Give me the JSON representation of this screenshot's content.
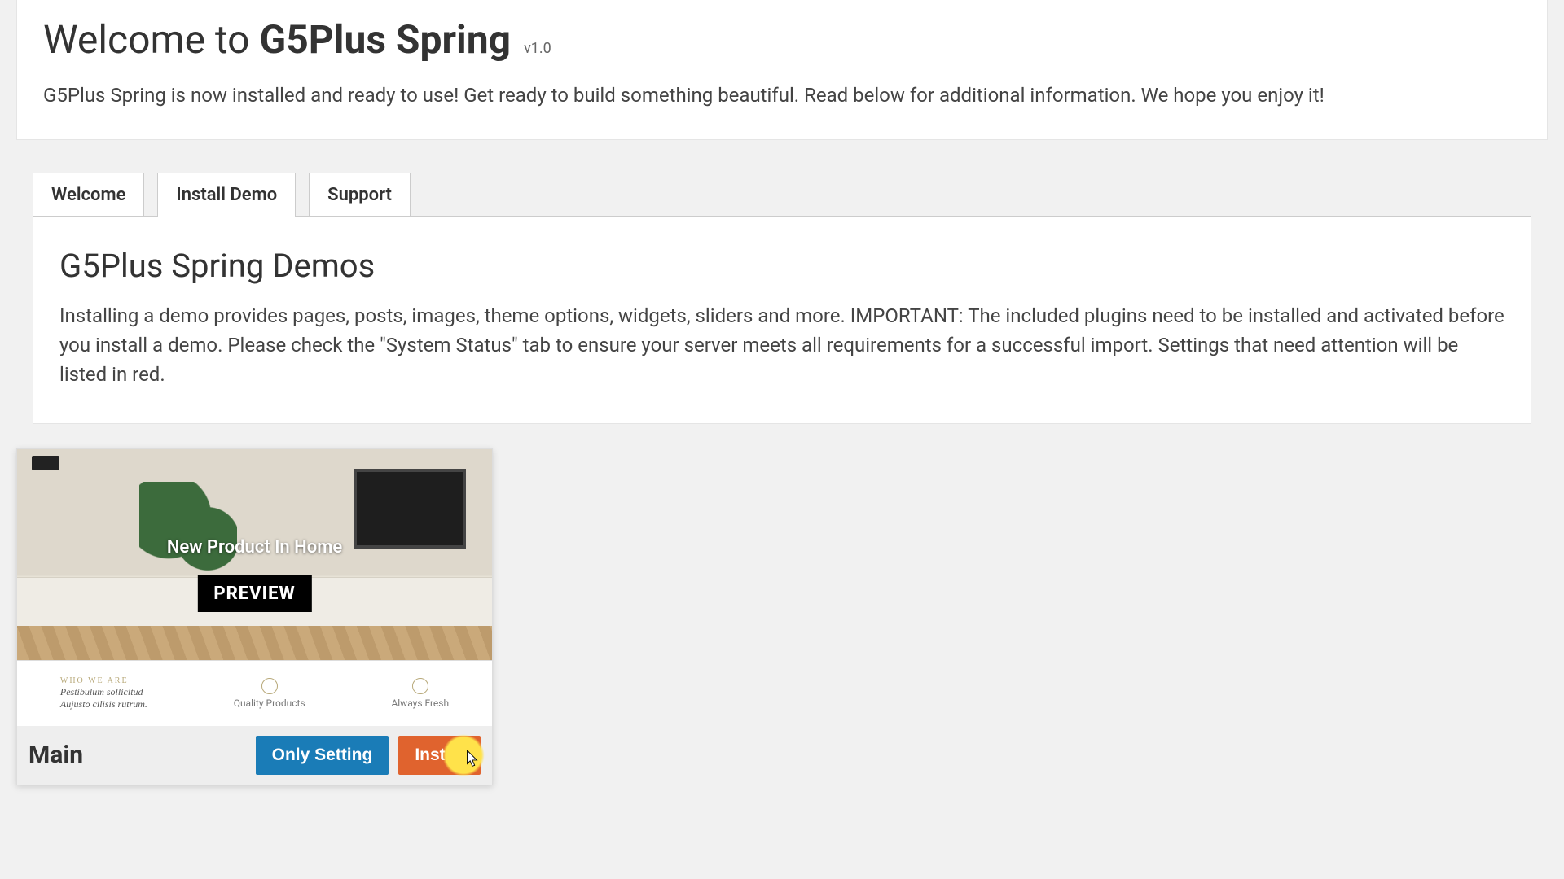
{
  "header": {
    "welcome_prefix": "Welcome to ",
    "product_name": "G5Plus Spring",
    "version": "v1.0",
    "subtitle": "G5Plus Spring is now installed and ready to use! Get ready to build something beautiful. Read below for additional information. We hope you enjoy it!"
  },
  "tabs": {
    "welcome": "Welcome",
    "install_demo": "Install Demo",
    "support": "Support",
    "active": "install_demo"
  },
  "panel": {
    "title": "G5Plus Spring Demos",
    "body": "Installing a demo provides pages, posts, images, theme options, widgets, sliders and more. IMPORTANT: The included plugins need to be installed and activated before you install a demo. Please check the \"System Status\" tab to ensure your server meets all requirements for a successful import. Settings that need attention will be listed in red."
  },
  "demos": [
    {
      "name": "Main",
      "hero_caption": "New Product In Home",
      "preview_label": "PREVIEW",
      "below_lead_sub": "WHO WE ARE",
      "below_lead_1": "Pestibulum sollicitud",
      "below_lead_2": "Aujusto cilisis rutrum.",
      "below_col1": "Quality Products",
      "below_col2": "Always Fresh",
      "only_setting_label": "Only Setting",
      "install_label": "Install"
    }
  ]
}
